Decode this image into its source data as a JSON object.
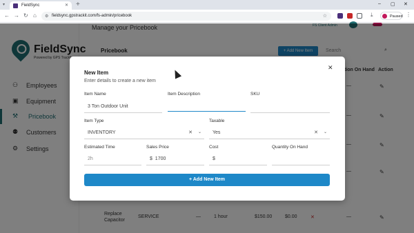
{
  "browser": {
    "tab_title": "FieldSync",
    "url": "fieldsync.gpstrackit.com/fs-admin/pricebook",
    "profile_status": "Paused"
  },
  "app": {
    "logo_name": "FieldSync",
    "logo_sub": "Powered by GPS Trackit",
    "nav": [
      {
        "label": "Employees",
        "icon": "person-icon"
      },
      {
        "label": "Equipment",
        "icon": "briefcase-icon"
      },
      {
        "label": "Pricebook",
        "icon": "wrench-icon"
      },
      {
        "label": "Customers",
        "icon": "customers-icon"
      },
      {
        "label": "Settings",
        "icon": "gear-icon"
      }
    ],
    "page_heading": "Manage your Pricebook",
    "topright_user": "FS Client Admin",
    "section_title": "Pricebook",
    "add_button": "+ Add New Item",
    "search_placeholder": "Search",
    "columns": {
      "on_hand": "Action On Hand",
      "action": "Action"
    },
    "dash": "—",
    "last_row": {
      "name": "Replace Capacitor",
      "type": "SERVICE",
      "desc": "—",
      "time": "1 hour",
      "price": "$150.00",
      "cost": "$0.00"
    }
  },
  "modal": {
    "title": "New Item",
    "subtitle": "Enter details to create a new item",
    "fields": {
      "item_name": {
        "label": "Item Name",
        "value": "3 Ton Outdoor Unit"
      },
      "item_description": {
        "label": "Item Description",
        "value": ""
      },
      "sku": {
        "label": "SKU",
        "value": ""
      },
      "item_type": {
        "label": "Item Type",
        "value": "INVENTORY"
      },
      "taxable": {
        "label": "Taxable",
        "value": "Yes"
      },
      "estimated_time": {
        "label": "Estimated Time",
        "placeholder": "2h"
      },
      "sales_price": {
        "label": "Sales Price",
        "prefix": "$",
        "value": "1700"
      },
      "cost": {
        "label": "Cost",
        "prefix": "$",
        "value": ""
      },
      "quantity_on_hand": {
        "label": "Quantity On Hand",
        "value": ""
      }
    },
    "submit_label": "+ Add New Item"
  }
}
